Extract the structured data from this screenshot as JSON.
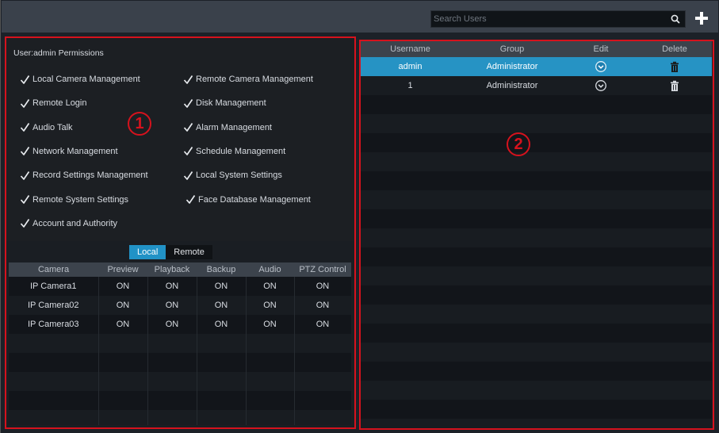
{
  "search": {
    "placeholder": "Search Users"
  },
  "permissions": {
    "title": "User:admin Permissions",
    "left": [
      "Local Camera Management",
      "Remote Login",
      "Audio Talk",
      "Network Management",
      "Record Settings Management",
      "Remote System Settings",
      "Account and Authority"
    ],
    "right": [
      "Remote Camera Management",
      "Disk Management",
      "Alarm Management",
      "Schedule Management",
      "Local System Settings",
      "Face Database Management"
    ]
  },
  "tabs": {
    "local": "Local",
    "remote": "Remote",
    "active": "Local"
  },
  "camera_table": {
    "columns": [
      "Camera",
      "Preview",
      "Playback",
      "Backup",
      "Audio",
      "PTZ Control"
    ],
    "rows": [
      [
        "IP Camera1",
        "ON",
        "ON",
        "ON",
        "ON",
        "ON"
      ],
      [
        "IP Camera02",
        "ON",
        "ON",
        "ON",
        "ON",
        "ON"
      ],
      [
        "IP Camera03",
        "ON",
        "ON",
        "ON",
        "ON",
        "ON"
      ]
    ]
  },
  "users_table": {
    "columns": [
      "Username",
      "Group",
      "Edit",
      "Delete"
    ],
    "rows": [
      {
        "username": "admin",
        "group": "Administrator",
        "selected": true
      },
      {
        "username": "1",
        "group": "Administrator",
        "selected": false
      }
    ]
  },
  "annotations": {
    "box1": "1",
    "box2": "2"
  },
  "colors": {
    "accent": "#2192c6",
    "annotation": "#d6121d",
    "background": "#1c2128"
  }
}
